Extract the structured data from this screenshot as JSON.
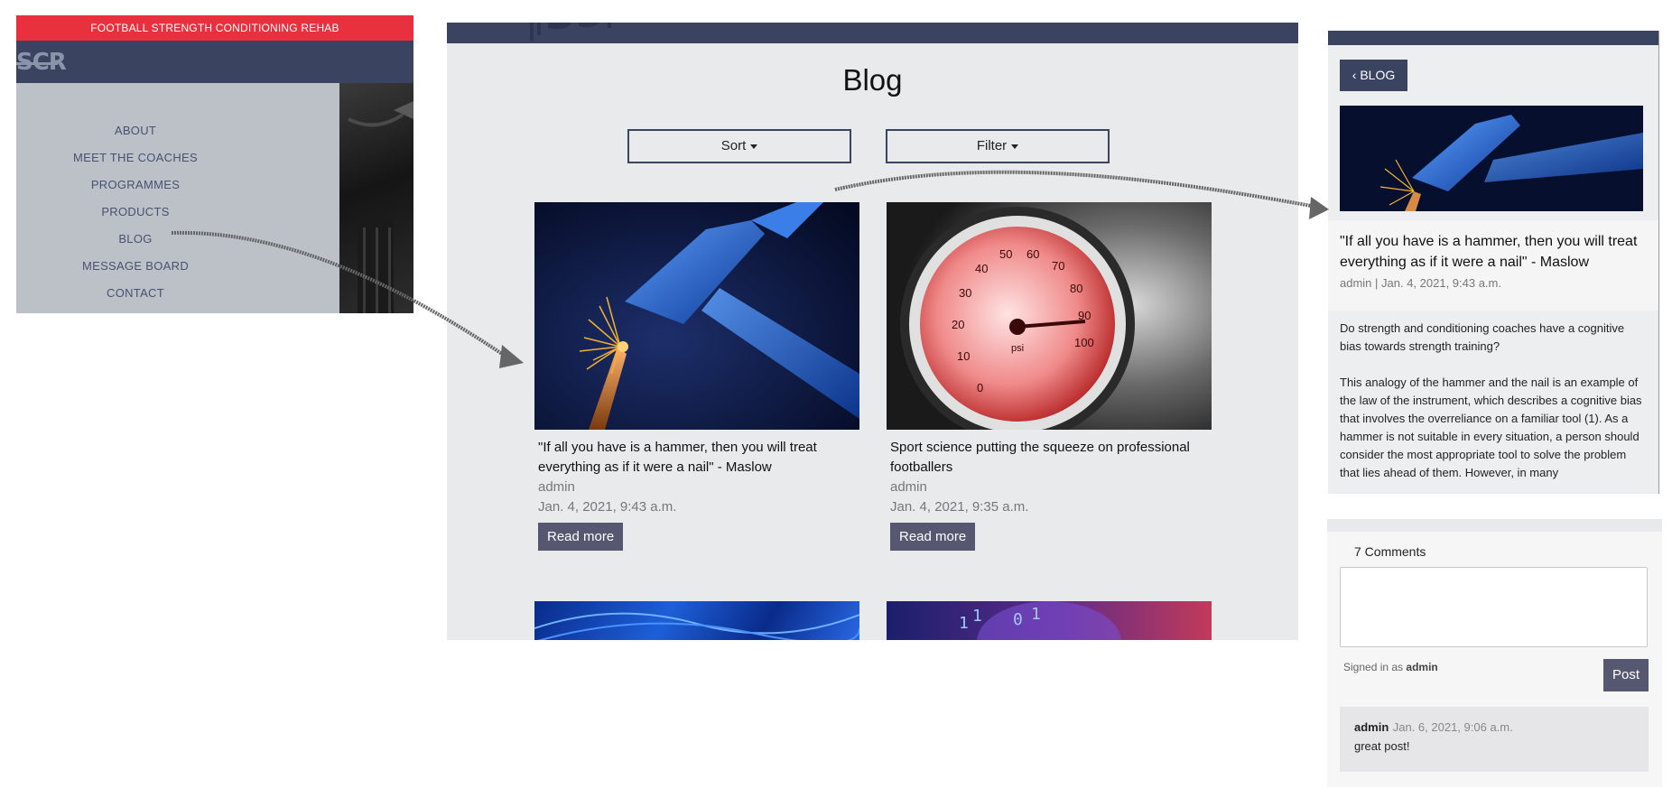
{
  "nav_panel": {
    "banner": "FOOTBALL STRENGTH CONDITIONING REHAB",
    "logo": "SCR",
    "menu_items": [
      "ABOUT",
      "MEET THE COACHES",
      "PROGRAMMES",
      "PRODUCTS",
      "BLOG",
      "MESSAGE BOARD",
      "CONTACT"
    ]
  },
  "blog_panel": {
    "title": "Blog",
    "sort_label": "Sort",
    "filter_label": "Filter",
    "posts": [
      {
        "title": "\"If all you have is a hammer, then you will treat everything as if it were a nail\" - Maslow",
        "author": "admin",
        "date": "Jan. 4, 2021, 9:43 a.m.",
        "read_more": "Read more",
        "image": "hammer-nail-image"
      },
      {
        "title": "Sport science putting the squeeze on professional footballers",
        "author": "admin",
        "date": "Jan. 4, 2021, 9:35 a.m.",
        "read_more": "Read more",
        "image": "pressure-gauge-image"
      }
    ]
  },
  "detail_panel": {
    "back_label": "BLOG",
    "title": "\"If all you have is a hammer, then you will treat everything as if it were a nail\" - Maslow",
    "meta": "admin | Jan. 4, 2021, 9:43 a.m.",
    "paragraphs": [
      "Do strength and conditioning coaches have a cognitive bias towards strength training?",
      "This analogy of the hammer and the nail is an example of the law of the instrument, which describes a cognitive bias that involves the overreliance on a familiar tool (1). As a hammer is not suitable in every situation, a person should consider the most appropriate tool to solve the problem that lies ahead of them. However, in many"
    ]
  },
  "comments_panel": {
    "count_label": "7 Comments",
    "signed_in_prefix": "Signed in as",
    "signed_in_user": "admin",
    "post_label": "Post",
    "comments": [
      {
        "author": "admin",
        "date": "Jan. 6, 2021, 9:06 a.m.",
        "text": "great post!"
      }
    ]
  },
  "colors": {
    "banner_red": "#e8303f",
    "navy": "#3a4461",
    "button_slate": "#555870",
    "menu_grey": "#bcc0c7"
  }
}
